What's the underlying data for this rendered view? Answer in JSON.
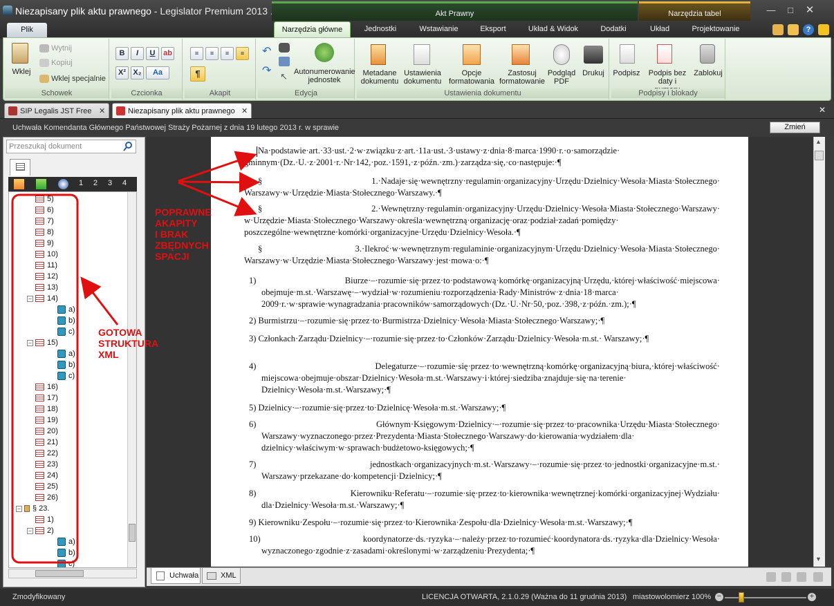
{
  "window": {
    "app_name": "Legislator Premium 2013 ...",
    "doc_name": "Niezapisany plik aktu prawnego",
    "separator": " - ",
    "controls": [
      "minimize-icon",
      "maximize-icon",
      "close-icon"
    ]
  },
  "context_tabs": {
    "akt": "Akt Prawny",
    "tabele": "Narzędzia tabel"
  },
  "ribbon_tabs": {
    "file": "Plik",
    "tabs": [
      "Narzędzia główne",
      "Jednostki",
      "Wstawianie",
      "Eksport",
      "Układ & Widok",
      "Dodatki",
      "Układ",
      "Projektowanie"
    ],
    "active": "Narzędzia główne"
  },
  "groups": {
    "schowek": {
      "label": "Schowek",
      "paste": "Wklej",
      "cut": "Wytnij",
      "copy": "Kopiuj",
      "paste_special": "Wklej specjalnie"
    },
    "czcionka": {
      "label": "Czcionka",
      "bold": "B",
      "italic": "I",
      "underline": "U",
      "sup": "X²",
      "sub": "X₂",
      "case": "Aa"
    },
    "akapit": {
      "label": "Akapit",
      "pilcrow": "¶"
    },
    "edycja": {
      "label": "Edycja",
      "autonum_l1": "Autonumerowanie",
      "autonum_l2": "jednostek"
    },
    "ustawienia": {
      "label": "Ustawienia dokumentu",
      "meta_l1": "Metadane",
      "meta_l2": "dokumentu",
      "settings_l1": "Ustawienia",
      "settings_l2": "dokumentu",
      "opts_l1": "Opcje",
      "opts_l2": "formatowania",
      "apply_l1": "Zastosuj",
      "apply_l2": "formatowanie",
      "pdf_l1": "Podgląd",
      "pdf_l2": "PDF",
      "print": "Drukuj"
    },
    "podpisy": {
      "label": "Podpisy i blokady",
      "sign": "Podpisz",
      "sign_nodate_l1": "Podpis bez",
      "sign_nodate_l2": "daty i numeru",
      "lock": "Zablokuj"
    }
  },
  "doc_tabs": [
    {
      "label": "SIP Legalis JST Free"
    },
    {
      "label": "Niezapisany plik aktu prawnego"
    }
  ],
  "doc_title": "Uchwała Komendanta Głównego Państwowej Straży Pożarnej z dnia 19 lutego 2013 r. w sprawie",
  "change_button": "Zmień",
  "search_placeholder": "Przeszukaj dokument",
  "tree_levels": [
    "1",
    "2",
    "3",
    "4"
  ],
  "tree": [
    {
      "label": "5)",
      "kind": "item",
      "indent": 1
    },
    {
      "label": "6)",
      "kind": "item",
      "indent": 1
    },
    {
      "label": "7)",
      "kind": "item",
      "indent": 1
    },
    {
      "label": "8)",
      "kind": "item",
      "indent": 1
    },
    {
      "label": "9)",
      "kind": "item",
      "indent": 1
    },
    {
      "label": "10)",
      "kind": "item",
      "indent": 1
    },
    {
      "label": "11)",
      "kind": "item",
      "indent": 1
    },
    {
      "label": "12)",
      "kind": "item",
      "indent": 1
    },
    {
      "label": "13)",
      "kind": "item",
      "indent": 1
    },
    {
      "label": "14)",
      "kind": "item-open",
      "indent": 1
    },
    {
      "label": "a)",
      "kind": "letter",
      "indent": 2
    },
    {
      "label": "b)",
      "kind": "letter",
      "indent": 2
    },
    {
      "label": "c)",
      "kind": "letter",
      "indent": 2
    },
    {
      "label": "15)",
      "kind": "item-open",
      "indent": 1
    },
    {
      "label": "a)",
      "kind": "letter",
      "indent": 2
    },
    {
      "label": "b)",
      "kind": "letter",
      "indent": 2
    },
    {
      "label": "c)",
      "kind": "letter",
      "indent": 2
    },
    {
      "label": "16)",
      "kind": "item",
      "indent": 1
    },
    {
      "label": "17)",
      "kind": "item",
      "indent": 1
    },
    {
      "label": "18)",
      "kind": "item",
      "indent": 1
    },
    {
      "label": "19)",
      "kind": "item",
      "indent": 1
    },
    {
      "label": "20)",
      "kind": "item",
      "indent": 1
    },
    {
      "label": "21)",
      "kind": "item",
      "indent": 1
    },
    {
      "label": "22)",
      "kind": "item",
      "indent": 1
    },
    {
      "label": "23)",
      "kind": "item",
      "indent": 1
    },
    {
      "label": "24)",
      "kind": "item",
      "indent": 1
    },
    {
      "label": "25)",
      "kind": "item",
      "indent": 1
    },
    {
      "label": "26)",
      "kind": "item",
      "indent": 1
    },
    {
      "label": "§ 23.",
      "kind": "section",
      "indent": 0
    },
    {
      "label": "1)",
      "kind": "item",
      "indent": 1
    },
    {
      "label": "2)",
      "kind": "item-open",
      "indent": 1
    },
    {
      "label": "a)",
      "kind": "letter",
      "indent": 2
    },
    {
      "label": "b)",
      "kind": "letter",
      "indent": 2
    },
    {
      "label": "c)",
      "kind": "letter",
      "indent": 2
    }
  ],
  "document": {
    "paragraphs": [
      "Na·podstawie·art.·33·ust.·2·w·związku·z·art.·11a·ust.·3·ustawy·z·dnia·8·marca·1990·r.·o·samorządzie· gminnym·(Dz.·U.·z·2001·r.·Nr·142,·poz.·1591,·z·późn.·zm.)·zarządza·się,·co·następuje:·¶",
      "§ 1.·Nadaje·się·wewnętrzny·regulamin·organizacyjny·Urzędu·Dzielnicy·Wesoła·Miasta·Stołecznego· Warszawy·w·Urzędzie·Miasta·Stołecznego·Warszawy.·¶",
      "§ 2.·Wewnętrzny·regulamin·organizacyjny·Urzędu·Dzielnicy·Wesoła·Miasta·Stołecznego·Warszawy· w·Urzędzie·Miasta·Stołecznego·Warszawy·określa·wewnętrzną·organizację·oraz·podział·zadań·pomiędzy· poszczególne·wewnętrzne·komórki·organizacyjne·Urzędu·Dzielnicy·Wesoła.·¶",
      "§ 3.·Ilekroć·w·wewnętrznym·regulaminie·organizacyjnym·Urzędu·Dzielnicy·Wesoła·Miasta·Stołecznego· Warszawy·w·Urzędzie·Miasta·Stołecznego·Warszawy·jest·mowa·o:·¶"
    ],
    "items": [
      "1) Biurze·–·rozumie·się·przez·to·podstawową·komórkę·organizacyjną·Urzędu,·której·właściwość·miejscowa· obejmuje·m.st.·Warszawę·–·wydział·w·rozumieniu·rozporządzenia·Rady·Ministrów·z·dnia·18·marca· 2009·r.·w·sprawie·wynagradzania·pracowników·samorządowych·(Dz.·U.·Nr·50,·poz.·398,·z·późn.·zm.);·¶",
      "2) Burmistrzu·–·rozumie·się·przez·to·Burmistrza·Dzielnicy·Wesoła·Miasta·Stołecznego·Warszawy;·¶",
      "3) Członkach·Zarządu·Dzielnicy·–·rozumie·się·przez·to·Członków·Zarządu·Dzielnicy·Wesoła·m.st.· Warszawy;·¶",
      "4) Delegaturze·–·rozumie·się·przez·to·wewnętrzną·komórkę·organizacyjną·biura,·której·właściwość· miejscowa·obejmuje·obszar·Dzielnicy·Wesoła·m.st.·Warszawy·i·której·siedziba·znajduje·się·na·terenie· Dzielnicy·Wesoła·m.st.·Warszawy;·¶",
      "5) Dzielnicy·–·rozumie·się·przez·to·Dzielnicę·Wesoła·m.st.·Warszawy;·¶",
      "6) Głównym·Księgowym·Dzielnicy·–·rozumie·się·przez·to·pracownika·Urzędu·Miasta·Stołecznego· Warszawy·wyznaczonego·przez·Prezydenta·Miasta·Stołecznego·Warszawy·do·kierowania·wydziałem·dla· dzielnicy·właściwym·w·sprawach·budżetowo-księgowych;·¶",
      "7) jednostkach·organizacyjnych·m.st.·Warszawy·–·rozumie·się·przez·to·jednostki·organizacyjne·m.st.· Warszawy·przekazane·do·kompetencji·Dzielnicy;·¶",
      "8) Kierowniku·Referatu·–·rozumie·się·przez·to·kierownika·wewnętrznej·komórki·organizacyjnej·Wydziału· dla·Dzielnicy·Wesoła·m.st.·Warszawy;·¶",
      "9) Kierowniku·Zespołu·–·rozumie·się·przez·to·Kierownika·Zespołu·dla·Dzielnicy·Wesoła·m.st.·Warszawy;·¶",
      "10) koordynatorze·ds.·ryzyka·–·należy·przez·to·rozumieć·koordynatora·ds.·ryzyka·dla·Dzielnicy·Wesoła· wyznaczonego·zgodnie·z·zasadami·określonymi·w·zarządzeniu·Prezydenta;·¶"
    ]
  },
  "bottom_tabs": {
    "uchwala": "Uchwała",
    "xml": "XML"
  },
  "annotations": {
    "right_l1": "POPRAWNE",
    "right_l2": "AKAPITY",
    "right_l3": "I BRAK",
    "right_l4": "ZBĘDNYCH",
    "right_l5": "SPACJI",
    "left_l1": "GOTOWA",
    "left_l2": "STRUKTURA",
    "left_l3": "XML",
    "color": "#e01010"
  },
  "status": {
    "left": "Zmodyfikowany",
    "license": "LICENCJA OTWARTA, 2.1.0.29 (Ważna do 11 grudnia 2013)",
    "user": "miastowolomierz",
    "zoom": "100%"
  }
}
